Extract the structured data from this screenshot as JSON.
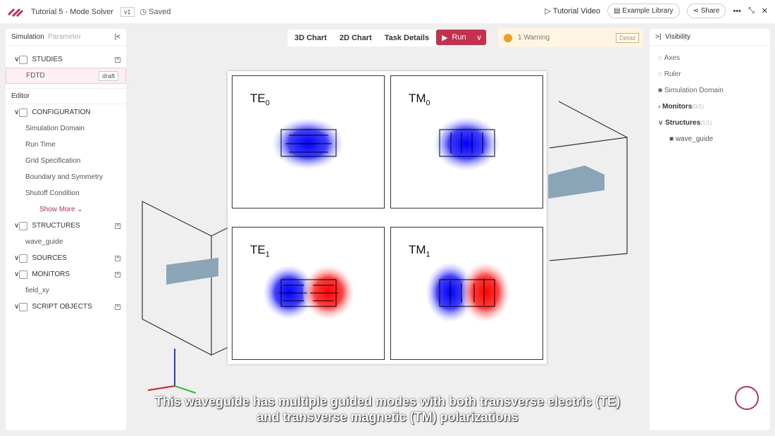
{
  "header": {
    "title": "Tutorial 5 - Mode Solver",
    "version": "v1",
    "saved": "Saved",
    "tutorial_video": "Tutorial Video",
    "example_library": "Example Library",
    "share": "Share"
  },
  "left": {
    "tab_simulation": "Simulation",
    "tab_parameter": "Parameter",
    "studies": "STUDIES",
    "fdtd": "FDTD",
    "draft": "draft",
    "editor": "Editor",
    "configuration": "CONFIGURATION",
    "config_items": [
      "Simulation Domain",
      "Run Time",
      "Grid Specification",
      "Boundary and Symmetry",
      "Shutoff Condition"
    ],
    "show_more": "Show More",
    "structures": "STRUCTURES",
    "wave_guide": "wave_guide",
    "sources": "SOURCES",
    "monitors": "MONITORS",
    "field_xy": "field_xy",
    "script_objects": "SCRIPT OBJECTS"
  },
  "toolbar": {
    "tab_3d": "3D Chart",
    "tab_2d": "2D Chart",
    "task_details": "Task Details",
    "run": "Run",
    "warning": "1 Warning",
    "detail": "Detail"
  },
  "right": {
    "title": "Visibility",
    "axes": "Axes",
    "ruler": "Ruler",
    "simulation_domain": "Simulation Domain",
    "monitors": "Monitors",
    "monitors_count": "(0/1)",
    "structures": "Structures",
    "structures_count": "(1/1)",
    "wave_guide": "wave_guide"
  },
  "modes": [
    {
      "name": "TE",
      "sub": "0"
    },
    {
      "name": "TM",
      "sub": "0"
    },
    {
      "name": "TE",
      "sub": "1"
    },
    {
      "name": "TM",
      "sub": "1"
    }
  ],
  "caption": [
    "This waveguide has multiple guided modes with both transverse electric (TE)",
    "and transverse magnetic (TM) polarizations"
  ],
  "colors": {
    "accent": "#c5304f",
    "field_positive": "#ff0000",
    "field_negative": "#0000ff"
  }
}
